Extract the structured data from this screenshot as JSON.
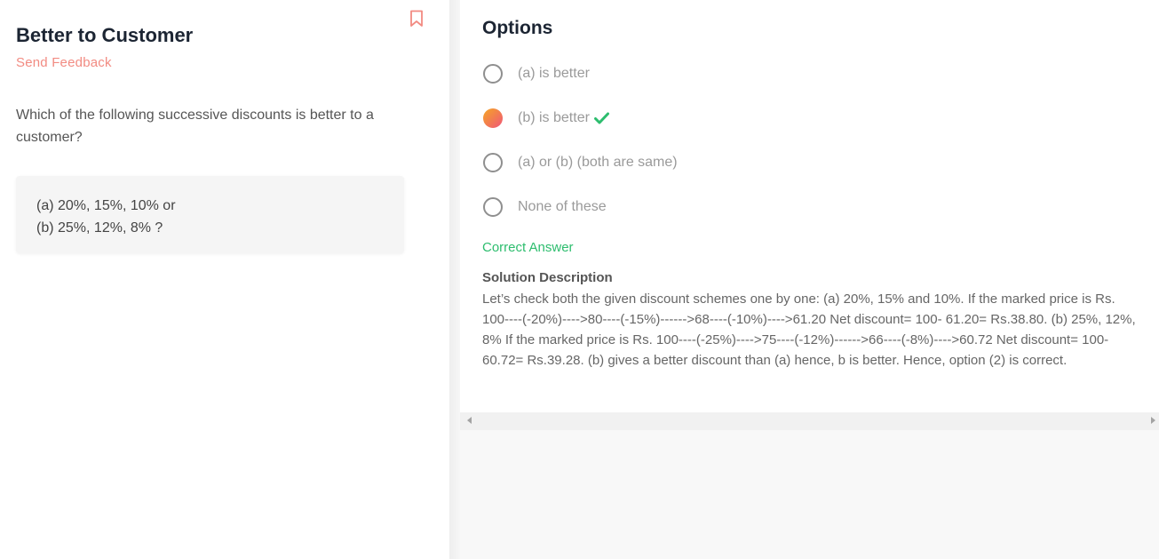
{
  "question": {
    "title": "Better to Customer",
    "feedback_label": "Send Feedback",
    "text": "Which of the following successive discounts is better to a customer?",
    "choices": [
      "(a) 20%, 15%, 10% or",
      "(b) 25%, 12%, 8% ?"
    ]
  },
  "options": {
    "title": "Options",
    "items": [
      {
        "label": "(a) is better",
        "selected": false,
        "correct": false
      },
      {
        "label": "(b) is better",
        "selected": true,
        "correct": true
      },
      {
        "label": "(a) or (b) (both are same)",
        "selected": false,
        "correct": false
      },
      {
        "label": "None of these",
        "selected": false,
        "correct": false
      }
    ]
  },
  "solution": {
    "correct_label": "Correct Answer",
    "title": "Solution Description",
    "text": "Let’s check both the given discount schemes one by one: (a) 20%, 15% and 10%. If the marked price is Rs. 100----(-20%)---->80----(-15%)------>68----(-10%)---->61.20 Net discount= 100- 61.20= Rs.38.80. (b) 25%, 12%, 8% If the marked price is Rs. 100----(-25%)---->75----(-12%)------>66----(-8%)---->60.72 Net discount= 100- 60.72= Rs.39.28. (b) gives a better discount than (a) hence, b is better. Hence, option (2) is correct."
  },
  "icons": {
    "bookmark": "bookmark-icon",
    "check": "check-icon",
    "scroll_left": "scroll-left-arrow",
    "scroll_right": "scroll-right-arrow"
  },
  "colors": {
    "accent": "#f28b82",
    "correct": "#2dbd6e",
    "selected_gradient_start": "#f5a623",
    "selected_gradient_end": "#f0567a"
  }
}
